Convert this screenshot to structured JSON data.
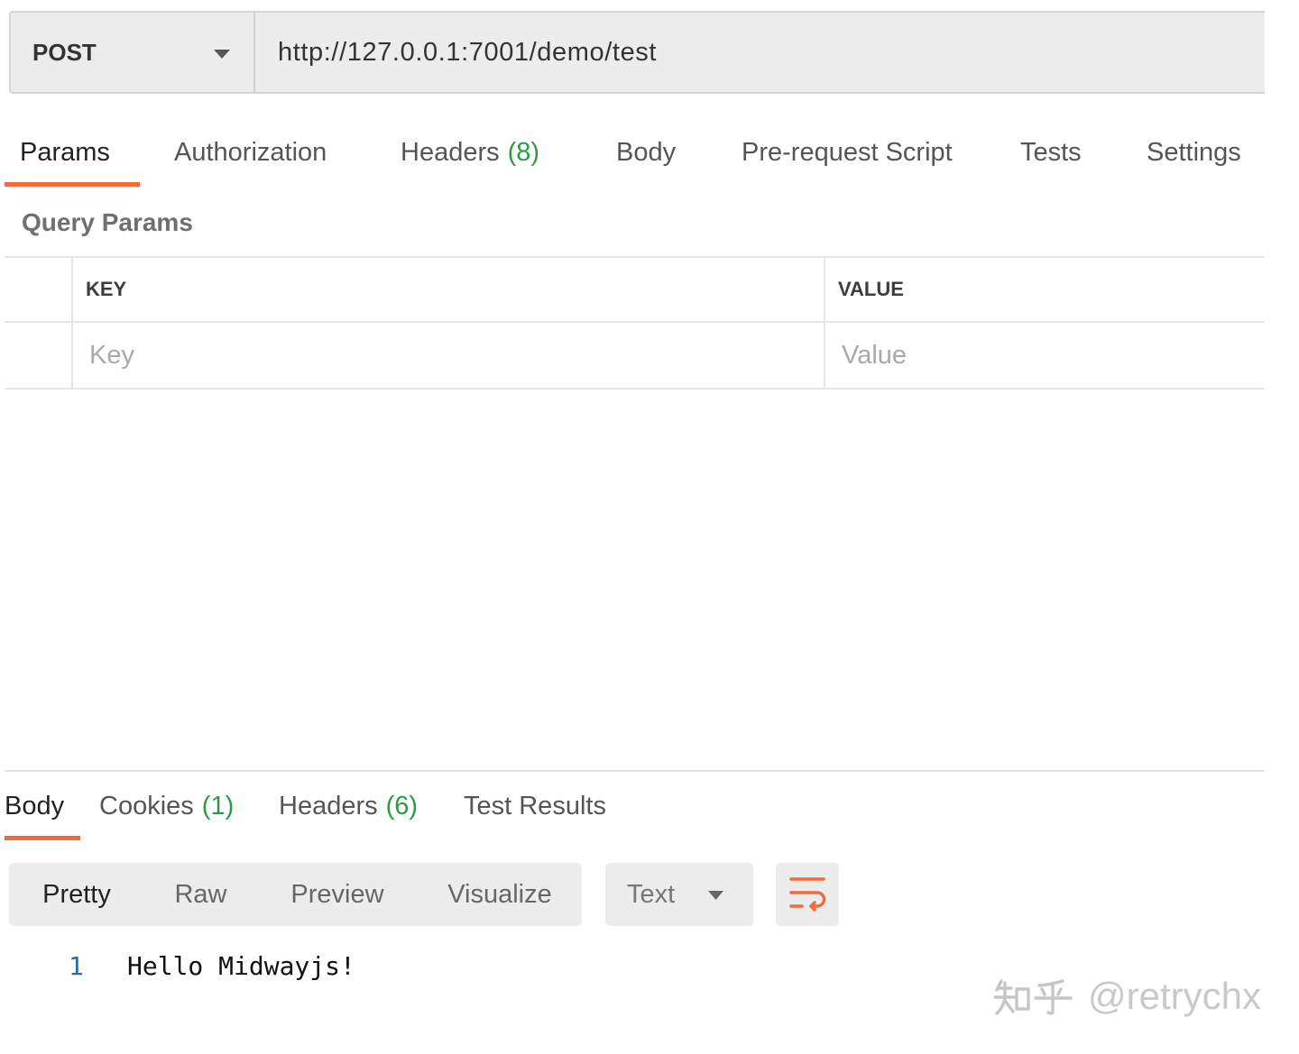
{
  "request": {
    "method": "POST",
    "url": "http://127.0.0.1:7001/demo/test"
  },
  "request_tabs": [
    {
      "label": "Params",
      "active": true
    },
    {
      "label": "Authorization"
    },
    {
      "label": "Headers",
      "count": "(8)"
    },
    {
      "label": "Body"
    },
    {
      "label": "Pre-request Script"
    },
    {
      "label": "Tests"
    },
    {
      "label": "Settings"
    }
  ],
  "query_params": {
    "title": "Query Params",
    "columns": {
      "key": "KEY",
      "value": "VALUE"
    },
    "new_row": {
      "key_placeholder": "Key",
      "value_placeholder": "Value"
    }
  },
  "response_tabs": [
    {
      "label": "Body",
      "active": true
    },
    {
      "label": "Cookies",
      "count": "(1)"
    },
    {
      "label": "Headers",
      "count": "(6)"
    },
    {
      "label": "Test Results"
    }
  ],
  "response_toolbar": {
    "view_modes": [
      {
        "label": "Pretty",
        "active": true
      },
      {
        "label": "Raw"
      },
      {
        "label": "Preview"
      },
      {
        "label": "Visualize"
      }
    ],
    "format": "Text"
  },
  "response_body": {
    "lines": [
      {
        "number": "1",
        "text": "Hello Midwayjs!"
      }
    ]
  },
  "icons": {
    "method_dropdown": "chevron-down-icon",
    "format_dropdown": "chevron-down-icon",
    "wrap_toggle": "wrap-lines-icon"
  },
  "colors": {
    "accent": "#f26b3a",
    "count": "#2e9a48",
    "line_number": "#2d6e9d",
    "panel_bg": "#ececec"
  },
  "watermark": {
    "logo": "知乎",
    "handle": "@retrychx"
  }
}
